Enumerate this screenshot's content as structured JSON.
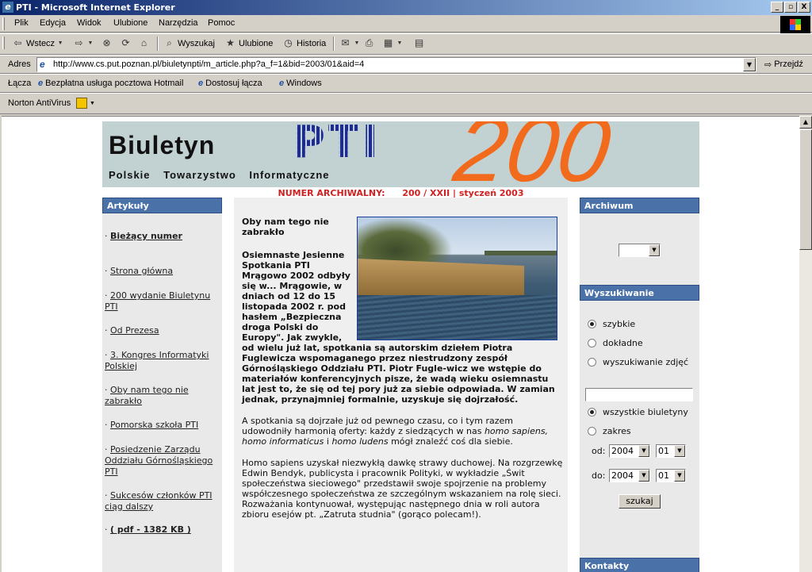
{
  "window": {
    "title": "PTI - Microsoft Internet Explorer",
    "controls": [
      "_",
      "ⓐ",
      "X"
    ]
  },
  "menu": [
    "Plik",
    "Edycja",
    "Widok",
    "Ulubione",
    "Narzędzia",
    "Pomoc"
  ],
  "toolbar": {
    "back": "Wstecz",
    "search": "Wyszukaj",
    "favorites": "Ulubione",
    "history": "Historia"
  },
  "address": {
    "label": "Adres",
    "url": "http://www.cs.put.poznan.pl/biuletynpti/m_article.php?a_f=1&bid=2003/01&aid=4",
    "go": "Przejdź"
  },
  "links": {
    "label": "Łącza",
    "items": [
      "Bezpłatna usługa pocztowa Hotmail",
      "Dostosuj łącza",
      "Windows"
    ]
  },
  "norton": {
    "label": "Norton AntiVirus"
  },
  "banner": {
    "title": "Biuletyn",
    "pti": "PTI",
    "subtitle": "Polskie Towarzystwo Informatyczne",
    "number": "200"
  },
  "archive_line": {
    "label": "NUMER ARCHIWALNY:",
    "value": "200 / XXII | styczeń 2003"
  },
  "left": {
    "heading": "Artykuły",
    "items": [
      "Bieżący numer",
      "Strona główna",
      "200 wydanie Biuletynu PTI",
      "Od Prezesa",
      "3. Kongres Informatyki Polskiej",
      "Oby nam tego nie zabrakło",
      "Pomorska szkoła PTI",
      "Posiedzenie Zarządu Oddziału Górnośląskiego PTI",
      "Sukcesów członków PTI ciąg dalszy",
      "( pdf - 1382 KB )"
    ]
  },
  "article": {
    "title": "Oby nam tego nie zabrakło",
    "lead_a": "Osiemnaste Jesienne Spotkania PTI Mrągowo 2002 odbyły się w... Mrągowie, w dniach od 12 do 15 listopada 2002 r. pod hasłem „Bezpieczna droga Polski do Europy\". Jak zwykle,",
    "lead_b": "od wielu już lat, spotkania są autorskim dziełem Piotra Fuglewicza wspomaganego przez niestrudzony zespół Górnośląskiego Oddziału PTI. Piotr Fugle-wicz we wstępie do materiałów konferencyjnych pisze, że wadą wieku osiemnastu lat jest to, że się od tej pory już za siebie odpowiada. W zamian jednak, przynajmniej formalnie, uzyskuje się dojrzałość.",
    "p2_a": "A spotkania są dojrzałe już od pewnego czasu, co i tym razem udowodniły harmonią oferty: każdy z siedzących w nas",
    "p2_b": "homo sapiens, homo informaticus",
    "p2_c": "i",
    "p2_d": "homo ludens",
    "p2_e": "mógł znaleźć coś dla siebie.",
    "p3": "Homo sapiens uzyskał niezwykłą dawkę strawy duchowej. Na rozgrzewkę Edwin Bendyk, publicysta i pracownik Polityki, w wykładzie „Świt społeczeństwa sieciowego\" przedstawił swoje spojrzenie na problemy współczesnego społeczeństwa ze szczególnym wskazaniem na rolę sieci. Rozważania kontynuował, występując następnego dnia w roli autora zbioru esejów pt. „Zatruta studnia\" (gorąco polecam!)."
  },
  "right": {
    "archive_heading": "Archiwum",
    "search_heading": "Wyszukiwanie",
    "search_modes": [
      "szybkie",
      "dokładne",
      "wyszukiwanie zdjęć"
    ],
    "selected_mode": "szybkie",
    "scope": [
      "wszystkie biuletyny",
      "zakres"
    ],
    "selected_scope": "wszystkie biuletyny",
    "from_label": "od:",
    "to_label": "do:",
    "from_year": "2004",
    "from_month": "01",
    "to_year": "2004",
    "to_month": "01",
    "search_button": "szukaj",
    "contacts_heading": "Kontakty"
  }
}
